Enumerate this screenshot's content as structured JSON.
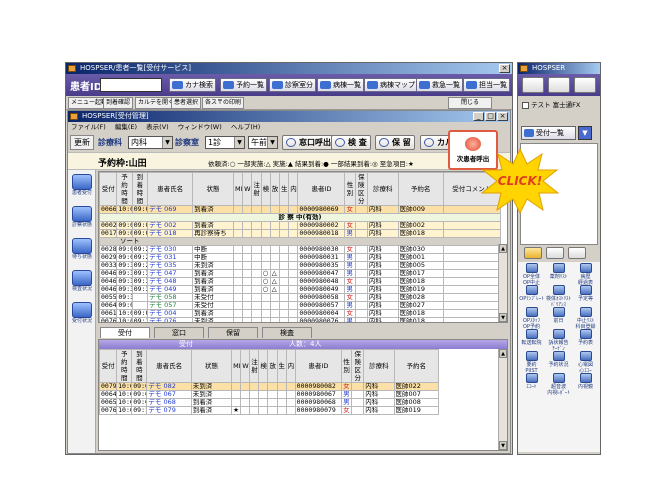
{
  "main_window": {
    "title": "HOSPSER/患者一覧[受付サービス]",
    "patient_id_label": "患者ID",
    "toolbar": [
      {
        "label": "カナ検索"
      },
      {
        "label": "予約一覧"
      },
      {
        "label": "診察室分"
      },
      {
        "label": "病棟一覧"
      },
      {
        "label": "病棟マップ"
      },
      {
        "label": "救急一覧"
      },
      {
        "label": "担当一覧"
      }
    ],
    "toolbar2": [
      "メニュー起動",
      "到着確認",
      "カルテを開く",
      "患者選択",
      "各ス〒の印刷"
    ],
    "close_button": "閉じる"
  },
  "inner_window": {
    "title": "HOSPSER[受付管理]",
    "menu": [
      "ファイル(F)",
      "編集(E)",
      "表示(V)",
      "ウィンドウ(W)",
      "ヘルプ(H)"
    ],
    "refresh_button": "更新",
    "dept_label": "診療科",
    "dept_value": "内科",
    "room_label": "診察室",
    "room_value": "1診",
    "time_value": "午前",
    "buttons": {
      "call": "窓口呼出",
      "exam": "検 査",
      "hold": "保 留",
      "karte": "カルテ開く"
    },
    "frame_label": "予約枠:山田",
    "legend": "依頼済:○ 一部実施:△ 実施:▲ 結果到着:● 一部結果到着:◎ 至急項目:★"
  },
  "left_sidebar": [
    {
      "icon": "reception-icon",
      "label": "患者受付"
    },
    {
      "icon": "consult-icon",
      "label": "診察状態"
    },
    {
      "icon": "waiting-icon",
      "label": "待ち状態"
    },
    {
      "icon": "checkup-icon",
      "label": "検査状況"
    },
    {
      "icon": "visit-icon",
      "label": "受付状況"
    }
  ],
  "upper_table": {
    "headers": [
      "受付",
      "予約時間",
      "到着時間",
      "患者氏名",
      "状態",
      "MI",
      "WI",
      "注射",
      "検",
      "放",
      "生",
      "内",
      "患者ID",
      "性別",
      "保険区分",
      "診療科",
      "予約名",
      "受付コメント"
    ],
    "top_row": {
      "no": "0066",
      "t1": "10:00",
      "t2": "09:06",
      "name": "デモ 069",
      "status": "到着済",
      "id": "0000980069",
      "sex": "女",
      "dept": "内科",
      "doc": "医師009"
    },
    "section_label": "診 察 中(有効)",
    "section_rows": [
      {
        "no": "0002",
        "t1": "09:00",
        "t2": "09:02",
        "name": "デモ 002",
        "status": "到着済",
        "id": "0000980002",
        "sex": "女",
        "dept": "内科",
        "doc": "医師002"
      },
      {
        "no": "0017",
        "t1": "09:00",
        "t2": "09:00",
        "name": "デモ 018",
        "status": "再診察待ち",
        "id": "0000980018",
        "sex": "男",
        "dept": "内科",
        "doc": "医師018"
      }
    ],
    "sort_label": "ソート",
    "rows": [
      {
        "no": "0028",
        "t1": "09:00",
        "t2": "09:20",
        "name": "デモ 030",
        "status": "中断",
        "marks": "",
        "id": "0000980030",
        "sex": "女",
        "dept": "内科",
        "doc": "医師030"
      },
      {
        "no": "0029",
        "t1": "09:00",
        "t2": "09:29",
        "name": "デモ 031",
        "status": "中断",
        "marks": "",
        "id": "0000980031",
        "sex": "男",
        "dept": "内科",
        "doc": "医師001"
      },
      {
        "no": "0033",
        "t1": "09:30",
        "t2": "09:29",
        "name": "デモ 035",
        "status": "未到済",
        "marks": "",
        "id": "0000980035",
        "sex": "男",
        "dept": "内科",
        "doc": "医師005"
      },
      {
        "no": "0046",
        "t1": "09:30",
        "t2": "09:34",
        "name": "デモ 047",
        "status": "到着済",
        "marks": "○△",
        "id": "0000980047",
        "sex": "男",
        "dept": "内科",
        "doc": "医師017"
      },
      {
        "no": "0046",
        "t1": "09:30",
        "t2": "09:35",
        "name": "デモ 048",
        "status": "到着済",
        "marks": "○△",
        "id": "0000980048",
        "sex": "女",
        "dept": "内科",
        "doc": "医師018"
      },
      {
        "no": "0046",
        "t1": "09:30",
        "t2": "09:36",
        "name": "デモ 049",
        "status": "到着済",
        "marks": "○△",
        "id": "0000980049",
        "sex": "男",
        "dept": "内科",
        "doc": "医師019"
      },
      {
        "no": "0055",
        "t1": "09:30",
        "t2": "",
        "name": "デモ 058",
        "status": "未受付",
        "marks": "",
        "id": "0000980058",
        "sex": "女",
        "dept": "内科",
        "doc": "医師028"
      },
      {
        "no": "0064",
        "t1": "09:00",
        "t2": "",
        "name": "デモ 057",
        "status": "未受付",
        "marks": "",
        "id": "0000980057",
        "sex": "男",
        "dept": "内科",
        "doc": "医師027"
      },
      {
        "no": "0061",
        "t1": "10:00",
        "t2": "09:00",
        "name": "デモ 004",
        "status": "到着済",
        "marks": "",
        "id": "0000980004",
        "sex": "女",
        "dept": "内科",
        "doc": "医師018"
      },
      {
        "no": "0076",
        "t1": "10:00",
        "t2": "09:15",
        "name": "デモ 076",
        "status": "未到済",
        "marks": "",
        "id": "0000980076",
        "sex": "男",
        "dept": "内科",
        "doc": "医師018"
      }
    ]
  },
  "lower_tabs": [
    "受付",
    "窓口",
    "保留",
    "検査"
  ],
  "lower_section": {
    "label": "受付",
    "count": "人数：4人"
  },
  "lower_table": {
    "headers": [
      "受付",
      "予約時間",
      "到着時間",
      "患者氏名",
      "状態",
      "MI",
      "WI",
      "注射",
      "検",
      "放",
      "生",
      "内",
      "患者ID",
      "性別",
      "保険区分",
      "診療科",
      "予約名"
    ],
    "rows": [
      {
        "no": "0079",
        "t1": "10:00",
        "t2": "09:01",
        "name": "デモ 082",
        "status": "未到済",
        "star": "",
        "id": "0000980082",
        "sex": "女",
        "dept": "内科",
        "doc": "医師022"
      },
      {
        "no": "0064",
        "t1": "10:00",
        "t2": "09:04",
        "name": "デモ 067",
        "status": "未到済",
        "star": "",
        "id": "0000980067",
        "sex": "男",
        "dept": "内科",
        "doc": "医師007"
      },
      {
        "no": "0065",
        "t1": "10:00",
        "t2": "09:05",
        "name": "デモ 068",
        "status": "到着済",
        "star": "",
        "id": "0000980068",
        "sex": "男",
        "dept": "内科",
        "doc": "医師008"
      },
      {
        "no": "0076",
        "t1": "10:00",
        "t2": "09:16",
        "name": "デモ 079",
        "status": "到着済",
        "star": "★",
        "id": "0000980079",
        "sex": "女",
        "dept": "内科",
        "doc": "医師019"
      }
    ]
  },
  "right_window": {
    "title": "HOSPSER",
    "user_label": "テスト 富士通FX",
    "reception_list_button": "受付一覧",
    "grid": [
      {
        "label": "OP全体",
        "label2": "OP中止"
      },
      {
        "label": "薬剤ﾘｽﾄ",
        "label2": ""
      },
      {
        "label": "病歴",
        "label2": "経過表"
      },
      {
        "label": "OPﾃﾝﾌﾟﾚｰﾄ",
        "label2": ""
      },
      {
        "label": "検体ｵｽﾄﾘｽﾄ",
        "label2": "ﾊﾞﾘｱﾝｽ"
      },
      {
        "label": "予定等",
        "label2": ""
      },
      {
        "label": "OPｽﾀｯﾌ",
        "label2": "OP予約"
      },
      {
        "label": "前日",
        "label2": ""
      },
      {
        "label": "中止ﾘｽﾄ",
        "label2": "科目登録"
      },
      {
        "label": "転送転院",
        "label2": ""
      },
      {
        "label": "訴状報告",
        "label2": "ﾁｰｹﾞﾝ"
      },
      {
        "label": "予約表",
        "label2": ""
      },
      {
        "label": "要約",
        "label2": "PIIST"
      },
      {
        "label": "予約状況",
        "label2": ""
      },
      {
        "label": "心電図",
        "label2": "心ｴｺｰ"
      },
      {
        "label": "ｴｺｰﾄ",
        "label2": ""
      },
      {
        "label": "超音波",
        "label2": "内視ﾚﾎﾟｰﾄ"
      },
      {
        "label": "内視鏡",
        "label2": ""
      }
    ]
  },
  "callout": {
    "next_patient": "次患者呼出",
    "click": "CLICK!"
  },
  "colors": {
    "accent_purple": "#5a4c9a",
    "titlebar_blue": "#0a246a",
    "highlight_orange": "#fbe1a7",
    "click_yellow": "#ffd400",
    "click_red": "#e04020"
  }
}
